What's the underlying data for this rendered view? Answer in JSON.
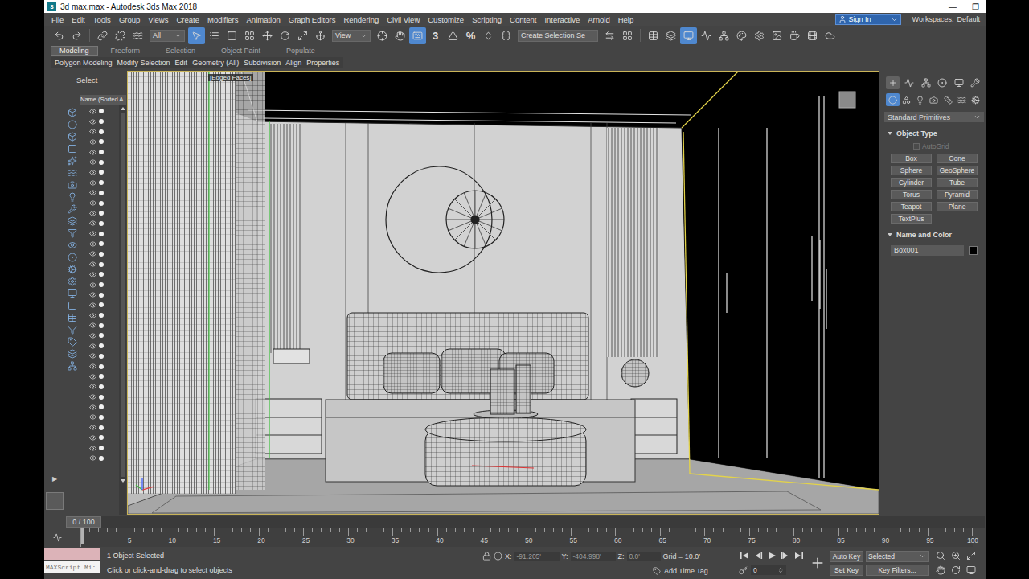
{
  "window": {
    "title": "3d max.max - Autodesk 3ds Max 2018",
    "logo": "3",
    "controls": [
      "—",
      "❐"
    ]
  },
  "menu": {
    "items": [
      "File",
      "Edit",
      "Tools",
      "Group",
      "Views",
      "Create",
      "Modifiers",
      "Animation",
      "Graph Editors",
      "Rendering",
      "Civil View",
      "Customize",
      "Scripting",
      "Content",
      "Interactive",
      "Arnold",
      "Help"
    ],
    "sign_in": "Sign In",
    "workspaces_label": "Workspaces:",
    "workspace": "Default"
  },
  "toolbar": {
    "filter": "All",
    "reference": "View",
    "selection_set": "Create Selection Se",
    "snap": "3",
    "percent": "%",
    "buttons": [
      {
        "selected": false
      },
      {
        "selected": false
      },
      {
        "selected": false
      },
      {
        "selected": false
      },
      {
        "selected": false
      },
      {
        "selected": true
      },
      {
        "selected": false
      },
      {
        "selected": false
      },
      {
        "selected": false
      },
      {
        "selected": false
      },
      {
        "selected": false
      },
      {
        "selected": false
      },
      {
        "selected": false
      },
      {
        "selected": false
      },
      {
        "selected": false
      },
      {
        "selected": true
      },
      {
        "selected": false
      },
      {
        "selected": false
      },
      {
        "selected": false
      },
      {
        "selected": false
      },
      {
        "selected": false
      },
      {
        "selected": false
      },
      {
        "selected": false
      },
      {
        "selected": false
      },
      {
        "selected": false
      },
      {
        "selected": true
      },
      {
        "selected": false
      },
      {
        "selected": false
      },
      {
        "selected": false
      },
      {
        "selected": false
      },
      {
        "selected": false
      },
      {
        "selected": false
      },
      {
        "selected": false
      },
      {
        "selected": false
      }
    ]
  },
  "ribbon": {
    "tabs": [
      {
        "label": "Modeling",
        "selected": true
      },
      {
        "label": "Freeform",
        "selected": false
      },
      {
        "label": "Selection",
        "selected": false
      },
      {
        "label": "Object Paint",
        "selected": false
      },
      {
        "label": "Populate",
        "selected": false
      }
    ],
    "groups": [
      "Polygon Modeling",
      "Modify Selection",
      "Edit",
      "Geometry (All)",
      "Subdivision",
      "Align",
      "Properties"
    ]
  },
  "scene_explorer": {
    "title": "Select",
    "column": "Name (Sorted A",
    "expand": "▶",
    "rows": [
      {
        "visible": true
      },
      {
        "visible": true
      },
      {
        "visible": true
      },
      {
        "visible": true
      },
      {
        "visible": true
      },
      {
        "visible": true
      },
      {
        "visible": true
      },
      {
        "visible": true
      },
      {
        "visible": true
      },
      {
        "visible": true
      },
      {
        "visible": true
      },
      {
        "visible": true
      },
      {
        "visible": true
      },
      {
        "visible": true
      },
      {
        "visible": true
      },
      {
        "visible": true
      },
      {
        "visible": true
      },
      {
        "visible": true
      },
      {
        "visible": true
      },
      {
        "visible": true
      },
      {
        "visible": true
      },
      {
        "visible": true
      },
      {
        "visible": true
      },
      {
        "visible": true
      },
      {
        "visible": true
      },
      {
        "visible": true
      },
      {
        "visible": true
      },
      {
        "visible": true
      },
      {
        "visible": true
      },
      {
        "visible": true
      },
      {
        "visible": true
      },
      {
        "visible": true
      },
      {
        "visible": true
      },
      {
        "visible": true
      },
      {
        "visible": true
      }
    ]
  },
  "viewport": {
    "label": "[Edged Faces]"
  },
  "command_panel": {
    "tabs": [
      {
        "selected": true
      },
      {
        "selected": false
      },
      {
        "selected": false
      },
      {
        "selected": false
      },
      {
        "selected": false
      },
      {
        "selected": false
      }
    ],
    "categories": [
      {
        "selected": true
      },
      {
        "selected": false
      },
      {
        "selected": false
      },
      {
        "selected": false
      },
      {
        "selected": false
      },
      {
        "selected": false
      },
      {
        "selected": false
      }
    ],
    "category": "Standard Primitives",
    "object_type": {
      "title": "Object Type",
      "expanded": true,
      "autogrid": {
        "label": "AutoGrid",
        "checked": false,
        "disabled": true
      },
      "buttons": [
        "Box",
        "Cone",
        "Sphere",
        "GeoSphere",
        "Cylinder",
        "Tube",
        "Torus",
        "Pyramid",
        "Teapot",
        "Plane",
        "TextPlus"
      ]
    },
    "name_and_color": {
      "title": "Name and Color",
      "expanded": true,
      "name": "Box001",
      "color": "#000000"
    }
  },
  "timeline": {
    "position": "0 / 100",
    "level": 0,
    "ticks": [
      "5",
      "10",
      "15",
      "20",
      "25",
      "30",
      "35",
      "40",
      "45",
      "50",
      "55",
      "60",
      "65",
      "70",
      "75",
      "80",
      "85",
      "90",
      "95",
      "100"
    ]
  },
  "status_bar": {
    "maxscript": "MAXScript Mi:",
    "selection": "1 Object Selected",
    "prompt": "Click or click-and-drag to select objects",
    "coords": [
      {
        "label": "X:",
        "value": "-91.205'"
      },
      {
        "label": "Y:",
        "value": "-404.998'"
      },
      {
        "label": "Z:",
        "value": "0.0'"
      }
    ],
    "grid": "Grid = 10.0'",
    "time_tag": "Add Time Tag",
    "frame": "0",
    "auto_key": {
      "label": "Auto Key",
      "on": false
    },
    "key_mode": "Selected",
    "set_key": "Set Key",
    "key_filters": "Key Filters..."
  }
}
